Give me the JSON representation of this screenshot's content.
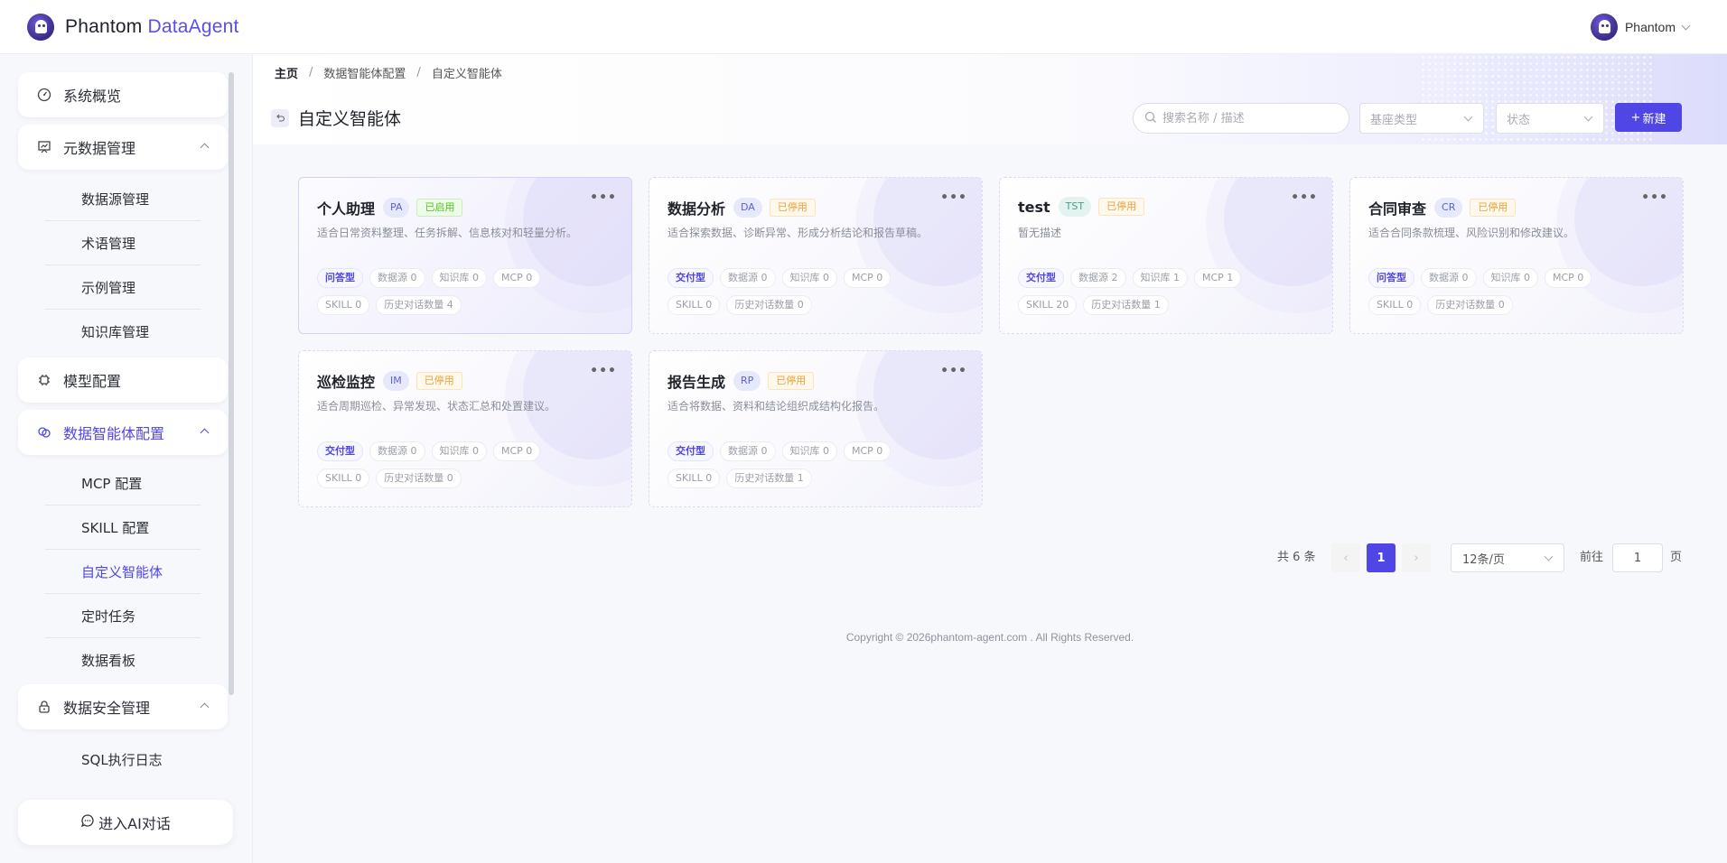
{
  "app": {
    "brand_part1": "Phantom ",
    "brand_part2": "DataAgent"
  },
  "user": {
    "name": "Phantom"
  },
  "sidebar": {
    "system_overview": "系统概览",
    "metadata": {
      "label": "元数据管理",
      "items": [
        "数据源管理",
        "术语管理",
        "示例管理",
        "知识库管理"
      ]
    },
    "model_config": "模型配置",
    "agent_config": {
      "label": "数据智能体配置",
      "items": [
        "MCP 配置",
        "SKILL 配置",
        "自定义智能体",
        "定时任务",
        "数据看板"
      ],
      "active_index": 2
    },
    "security": {
      "label": "数据安全管理",
      "items": [
        "SQL执行日志"
      ]
    },
    "ai_chat_button": "进入AI对话"
  },
  "breadcrumb": {
    "home": "主页",
    "parent": "数据智能体配置",
    "current": "自定义智能体",
    "separator": "/"
  },
  "page": {
    "title": "自定义智能体"
  },
  "toolbar": {
    "search_placeholder": "搜索名称 / 描述",
    "base_type_placeholder": "基座类型",
    "status_placeholder": "状态",
    "new_button": "新建"
  },
  "cards": [
    {
      "title": "个人助理",
      "code": "PA",
      "status": "已启用",
      "enabled": true,
      "desc": "适合日常资料整理、任务拆解、信息核对和轻量分析。",
      "type": "问答型",
      "datasource": "数据源 0",
      "knowledge": "知识库 0",
      "mcp": "MCP 0",
      "skill": "SKILL 0",
      "history": "历史对话数量 4"
    },
    {
      "title": "数据分析",
      "code": "DA",
      "status": "已停用",
      "enabled": false,
      "desc": "适合探索数据、诊断异常、形成分析结论和报告草稿。",
      "type": "交付型",
      "datasource": "数据源 0",
      "knowledge": "知识库 0",
      "mcp": "MCP 0",
      "skill": "SKILL 0",
      "history": "历史对话数量 0"
    },
    {
      "title": "test",
      "code": "TST",
      "status": "已停用",
      "enabled": false,
      "desc": "暂无描述",
      "type": "交付型",
      "datasource": "数据源 2",
      "knowledge": "知识库 1",
      "mcp": "MCP 1",
      "skill": "SKILL 20",
      "history": "历史对话数量 1"
    },
    {
      "title": "合同审查",
      "code": "CR",
      "status": "已停用",
      "enabled": false,
      "desc": "适合合同条款梳理、风险识别和修改建议。",
      "type": "问答型",
      "datasource": "数据源 0",
      "knowledge": "知识库 0",
      "mcp": "MCP 0",
      "skill": "SKILL 0",
      "history": "历史对话数量 0"
    },
    {
      "title": "巡检监控",
      "code": "IM",
      "status": "已停用",
      "enabled": false,
      "desc": "适合周期巡检、异常发现、状态汇总和处置建议。",
      "type": "交付型",
      "datasource": "数据源 0",
      "knowledge": "知识库 0",
      "mcp": "MCP 0",
      "skill": "SKILL 0",
      "history": "历史对话数量 0"
    },
    {
      "title": "报告生成",
      "code": "RP",
      "status": "已停用",
      "enabled": false,
      "desc": "适合将数据、资料和结论组织成结构化报告。",
      "type": "交付型",
      "datasource": "数据源 0",
      "knowledge": "知识库 0",
      "mcp": "MCP 0",
      "skill": "SKILL 0",
      "history": "历史对话数量 1"
    }
  ],
  "pagination": {
    "total": "共 6 条",
    "current_page": "1",
    "page_size": "12条/页",
    "goto_label": "前往",
    "goto_value": "1",
    "page_label": "页"
  },
  "footer": {
    "copyright": "Copyright © 2026phantom-agent.com . All Rights Reserved."
  },
  "colors": {
    "accent": "#4f46e5",
    "enabled": "#52c41a",
    "disabled": "#e6a23c"
  }
}
